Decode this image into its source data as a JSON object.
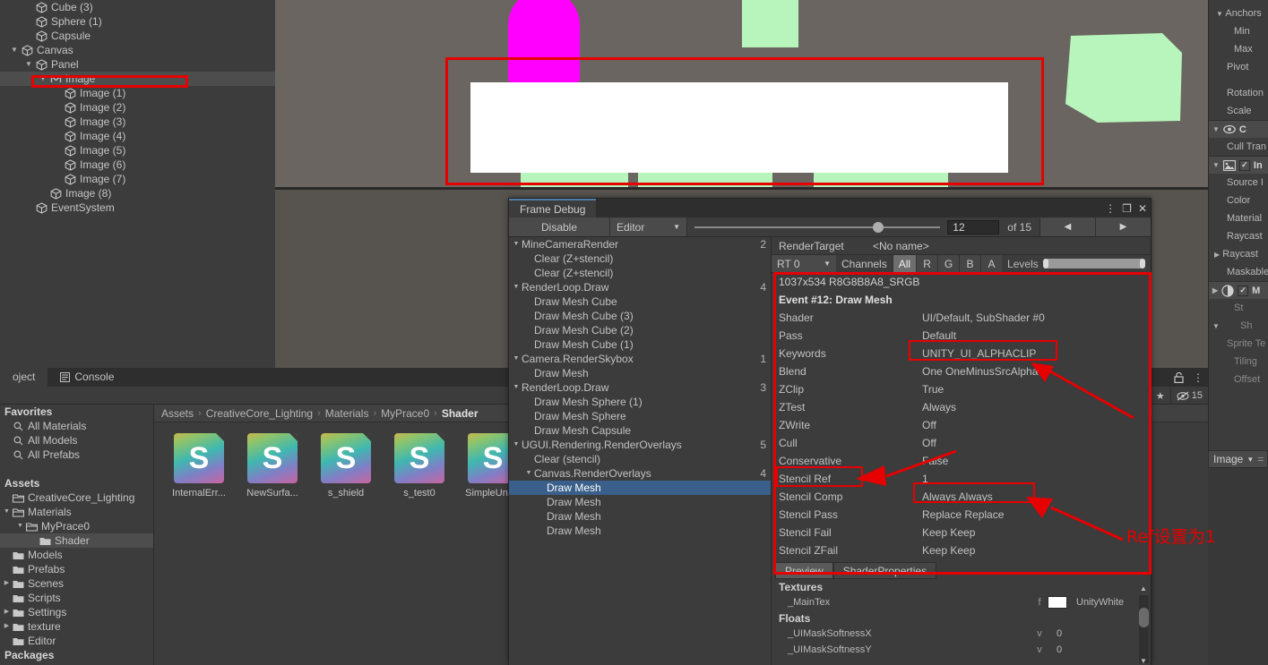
{
  "hierarchy": {
    "items": [
      {
        "label": "Cube (3)",
        "depth": 1,
        "fold": "",
        "icon": "cube-icon",
        "selected": false
      },
      {
        "label": "Sphere (1)",
        "depth": 1,
        "fold": "",
        "icon": "cube-icon",
        "selected": false
      },
      {
        "label": "Capsule",
        "depth": 1,
        "fold": "",
        "icon": "cube-icon",
        "selected": false
      },
      {
        "label": "Canvas",
        "depth": 0,
        "fold": "▼",
        "icon": "cube-icon",
        "selected": false
      },
      {
        "label": "Panel",
        "depth": 1,
        "fold": "▼",
        "icon": "cube-icon",
        "selected": false
      },
      {
        "label": "Image",
        "depth": 2,
        "fold": "▼",
        "icon": "ui-image-icon",
        "selected": true
      },
      {
        "label": "Image (1)",
        "depth": 3,
        "fold": "",
        "icon": "cube-icon",
        "selected": false
      },
      {
        "label": "Image (2)",
        "depth": 3,
        "fold": "",
        "icon": "cube-icon",
        "selected": false
      },
      {
        "label": "Image (3)",
        "depth": 3,
        "fold": "",
        "icon": "cube-icon",
        "selected": false
      },
      {
        "label": "Image (4)",
        "depth": 3,
        "fold": "",
        "icon": "cube-icon",
        "selected": false
      },
      {
        "label": "Image (5)",
        "depth": 3,
        "fold": "",
        "icon": "cube-icon",
        "selected": false
      },
      {
        "label": "Image (6)",
        "depth": 3,
        "fold": "",
        "icon": "cube-icon",
        "selected": false
      },
      {
        "label": "Image (7)",
        "depth": 3,
        "fold": "",
        "icon": "cube-icon",
        "selected": false
      },
      {
        "label": "Image (8)",
        "depth": 2,
        "fold": "",
        "icon": "cube-icon",
        "selected": false
      },
      {
        "label": "EventSystem",
        "depth": 1,
        "fold": "",
        "icon": "cube-icon",
        "selected": false
      }
    ]
  },
  "scene": {
    "background_color": "#6a6560",
    "magenta_color": "#ff00ff",
    "green_color": "#b8f5bc",
    "white_color": "#ffffff"
  },
  "inspector": {
    "rows": [
      {
        "label": "Anchors",
        "kind": "fold-row",
        "fold": "▼"
      },
      {
        "label": "Min",
        "kind": "ind2"
      },
      {
        "label": "Max",
        "kind": "ind2"
      },
      {
        "label": "Pivot",
        "kind": "ind"
      },
      {
        "label": "",
        "kind": "spacer"
      },
      {
        "label": "Rotation",
        "kind": "ind"
      },
      {
        "label": "Scale",
        "kind": "ind"
      }
    ],
    "canvas_section": {
      "title": "C",
      "icon": "eye-icon",
      "fold": "▼"
    },
    "canvas_rows": [
      {
        "label": "Cull Tran"
      }
    ],
    "image_section": {
      "title": "In",
      "icon": "image-component-icon",
      "fold": "▼",
      "checked": true
    },
    "image_rows": [
      {
        "label": "Source I"
      },
      {
        "label": "Color"
      },
      {
        "label": "Material"
      },
      {
        "label": "Raycast "
      },
      {
        "label": "Raycast ",
        "fold": "▶"
      },
      {
        "label": "Maskable"
      }
    ],
    "mask_section": {
      "title": "M",
      "icon": "mask-component-icon",
      "fold": "▶",
      "checked": true
    },
    "mask_rows": [
      {
        "label": "St"
      },
      {
        "label": "Sh",
        "fold": "▼"
      }
    ],
    "material_rows": [
      {
        "label": "Sprite Te"
      },
      {
        "label": "Tiling"
      },
      {
        "label": "Offset"
      }
    ],
    "footer_dropdown": "Image"
  },
  "project": {
    "tabs": [
      {
        "label": "oject",
        "active": true,
        "icon": ""
      },
      {
        "label": "Console",
        "active": false,
        "icon": "console-icon"
      }
    ],
    "tools": {
      "lock_icon": "lock-icon",
      "menu_icon": "kebab-menu-icon",
      "favorite_icon": "star-icon",
      "visibility_icon": "eye-slash-icon",
      "visibility_count": "15"
    },
    "tree": [
      {
        "label": "Favorites",
        "depth": 0,
        "bold": true,
        "icon": "",
        "fold": "",
        "selected": false
      },
      {
        "label": "All Materials",
        "depth": 0,
        "bold": false,
        "icon": "search-icon",
        "fold": "",
        "selected": false
      },
      {
        "label": "All Models",
        "depth": 0,
        "bold": false,
        "icon": "search-icon",
        "fold": "",
        "selected": false
      },
      {
        "label": "All Prefabs",
        "depth": 0,
        "bold": false,
        "icon": "search-icon",
        "fold": "",
        "selected": false
      },
      {
        "label": "",
        "depth": 0,
        "bold": false,
        "icon": "",
        "fold": "",
        "selected": false
      },
      {
        "label": "Assets",
        "depth": 0,
        "bold": true,
        "icon": "",
        "fold": "",
        "selected": false
      },
      {
        "label": "CreativeCore_Lighting",
        "depth": 0,
        "bold": false,
        "icon": "folder-open-icon",
        "fold": "",
        "selected": false
      },
      {
        "label": "Materials",
        "depth": 0,
        "bold": false,
        "icon": "folder-open-icon",
        "fold": "▼",
        "selected": false
      },
      {
        "label": "MyPrace0",
        "depth": 1,
        "bold": false,
        "icon": "folder-open-icon",
        "fold": "▼",
        "selected": false
      },
      {
        "label": "Shader",
        "depth": 2,
        "bold": false,
        "icon": "folder-icon",
        "fold": "",
        "selected": true
      },
      {
        "label": "Models",
        "depth": 0,
        "bold": false,
        "icon": "folder-icon",
        "fold": "",
        "selected": false
      },
      {
        "label": "Prefabs",
        "depth": 0,
        "bold": false,
        "icon": "folder-icon",
        "fold": "",
        "selected": false
      },
      {
        "label": "Scenes",
        "depth": 0,
        "bold": false,
        "icon": "folder-icon",
        "fold": "▶",
        "selected": false
      },
      {
        "label": "Scripts",
        "depth": 0,
        "bold": false,
        "icon": "folder-icon",
        "fold": "",
        "selected": false
      },
      {
        "label": "Settings",
        "depth": 0,
        "bold": false,
        "icon": "folder-icon",
        "fold": "▶",
        "selected": false
      },
      {
        "label": "texture",
        "depth": 0,
        "bold": false,
        "icon": "folder-icon",
        "fold": "▶",
        "selected": false
      },
      {
        "label": "Editor",
        "depth": 0,
        "bold": false,
        "icon": "folder-icon",
        "fold": "",
        "selected": false
      },
      {
        "label": "Packages",
        "depth": 0,
        "bold": true,
        "icon": "",
        "fold": "",
        "selected": false
      }
    ],
    "breadcrumb": [
      "Assets",
      "CreativeCore_Lighting",
      "Materials",
      "MyPrace0",
      "Shader"
    ],
    "assets": [
      {
        "name": "InternalErr...",
        "glyph": "S"
      },
      {
        "name": "NewSurfa...",
        "glyph": "S"
      },
      {
        "name": "s_shield",
        "glyph": "S"
      },
      {
        "name": "s_test0",
        "glyph": "S"
      },
      {
        "name": "SimpleUnli...",
        "glyph": "S"
      }
    ]
  },
  "frame_debugger": {
    "window_title": "Frame Debug",
    "window_controls": {
      "menu": "kebab-menu-icon",
      "maximize": "maximize-icon",
      "close": "close-icon"
    },
    "toolbar": {
      "disable_label": "Disable",
      "target_label": "Editor",
      "event_index": "12",
      "total_label": "of 15",
      "prev_label": "◀",
      "next_label": "▶"
    },
    "tree": [
      {
        "label": "MineCameraRender",
        "depth": 0,
        "fold": "▼",
        "count": "2",
        "selected": false
      },
      {
        "label": "Clear (Z+stencil)",
        "depth": 1,
        "fold": "",
        "count": "",
        "selected": false
      },
      {
        "label": "Clear (Z+stencil)",
        "depth": 1,
        "fold": "",
        "count": "",
        "selected": false
      },
      {
        "label": "RenderLoop.Draw",
        "depth": 0,
        "fold": "▼",
        "count": "4",
        "selected": false
      },
      {
        "label": "Draw Mesh Cube",
        "depth": 1,
        "fold": "",
        "count": "",
        "selected": false
      },
      {
        "label": "Draw Mesh Cube (3)",
        "depth": 1,
        "fold": "",
        "count": "",
        "selected": false
      },
      {
        "label": "Draw Mesh Cube (2)",
        "depth": 1,
        "fold": "",
        "count": "",
        "selected": false
      },
      {
        "label": "Draw Mesh Cube (1)",
        "depth": 1,
        "fold": "",
        "count": "",
        "selected": false
      },
      {
        "label": "Camera.RenderSkybox",
        "depth": 0,
        "fold": "▼",
        "count": "1",
        "selected": false
      },
      {
        "label": "Draw Mesh",
        "depth": 1,
        "fold": "",
        "count": "",
        "selected": false
      },
      {
        "label": "RenderLoop.Draw",
        "depth": 0,
        "fold": "▼",
        "count": "3",
        "selected": false
      },
      {
        "label": "Draw Mesh Sphere (1)",
        "depth": 1,
        "fold": "",
        "count": "",
        "selected": false
      },
      {
        "label": "Draw Mesh Sphere",
        "depth": 1,
        "fold": "",
        "count": "",
        "selected": false
      },
      {
        "label": "Draw Mesh Capsule",
        "depth": 1,
        "fold": "",
        "count": "",
        "selected": false
      },
      {
        "label": "UGUI.Rendering.RenderOverlays",
        "depth": 0,
        "fold": "▼",
        "count": "5",
        "selected": false
      },
      {
        "label": "Clear (stencil)",
        "depth": 1,
        "fold": "",
        "count": "",
        "selected": false
      },
      {
        "label": "Canvas.RenderOverlays",
        "depth": 1,
        "fold": "▼",
        "count": "4",
        "selected": false
      },
      {
        "label": "Draw Mesh",
        "depth": 2,
        "fold": "",
        "count": "",
        "selected": true
      },
      {
        "label": "Draw Mesh",
        "depth": 2,
        "fold": "",
        "count": "",
        "selected": false
      },
      {
        "label": "Draw Mesh",
        "depth": 2,
        "fold": "",
        "count": "",
        "selected": false
      },
      {
        "label": "Draw Mesh",
        "depth": 2,
        "fold": "",
        "count": "",
        "selected": false
      }
    ],
    "render_target": {
      "label": "RenderTarget",
      "value": "<No name>",
      "rt_select": "RT 0",
      "channels_label": "Channels",
      "channels": [
        {
          "label": "All",
          "active": true
        },
        {
          "label": "R",
          "active": false
        },
        {
          "label": "G",
          "active": false
        },
        {
          "label": "B",
          "active": false
        },
        {
          "label": "A",
          "active": false
        }
      ],
      "levels_label": "Levels"
    },
    "detail": {
      "resolution": "1037x534 R8G8B8A8_SRGB",
      "event_title": "Event #12: Draw Mesh",
      "rows": [
        {
          "key": "Shader",
          "value": "UI/Default, SubShader #0"
        },
        {
          "key": "Pass",
          "value": "Default"
        },
        {
          "key": "Keywords",
          "value": "UNITY_UI_ALPHACLIP"
        },
        {
          "key": "Blend",
          "value": "One OneMinusSrcAlpha"
        },
        {
          "key": "ZClip",
          "value": "True"
        },
        {
          "key": "ZTest",
          "value": "Always"
        },
        {
          "key": "ZWrite",
          "value": "Off"
        },
        {
          "key": "Cull",
          "value": "Off"
        },
        {
          "key": "Conservative",
          "value": "False"
        },
        {
          "key": "Stencil Ref",
          "value": "1"
        },
        {
          "key": "Stencil Comp",
          "value": "Always Always"
        },
        {
          "key": "Stencil Pass",
          "value": "Replace Replace"
        },
        {
          "key": "Stencil Fail",
          "value": "Keep Keep"
        },
        {
          "key": "Stencil ZFail",
          "value": "Keep Keep"
        }
      ]
    },
    "preview_tabs": [
      {
        "label": "Preview",
        "active": true
      },
      {
        "label": "ShaderProperties",
        "active": false
      }
    ],
    "shader_properties": {
      "textures_header": "Textures",
      "textures": [
        {
          "name": "_MainTex",
          "flag": "f",
          "swatch": "#ffffff",
          "value": "UnityWhite"
        }
      ],
      "floats_header": "Floats",
      "floats": [
        {
          "name": "_UIMaskSoftnessX",
          "flag": "v",
          "value": "0"
        },
        {
          "name": "_UIMaskSoftnessY",
          "flag": "v",
          "value": "0"
        }
      ]
    }
  },
  "annotations": {
    "note_text": "Ref设置为1",
    "color": "#e60000"
  }
}
